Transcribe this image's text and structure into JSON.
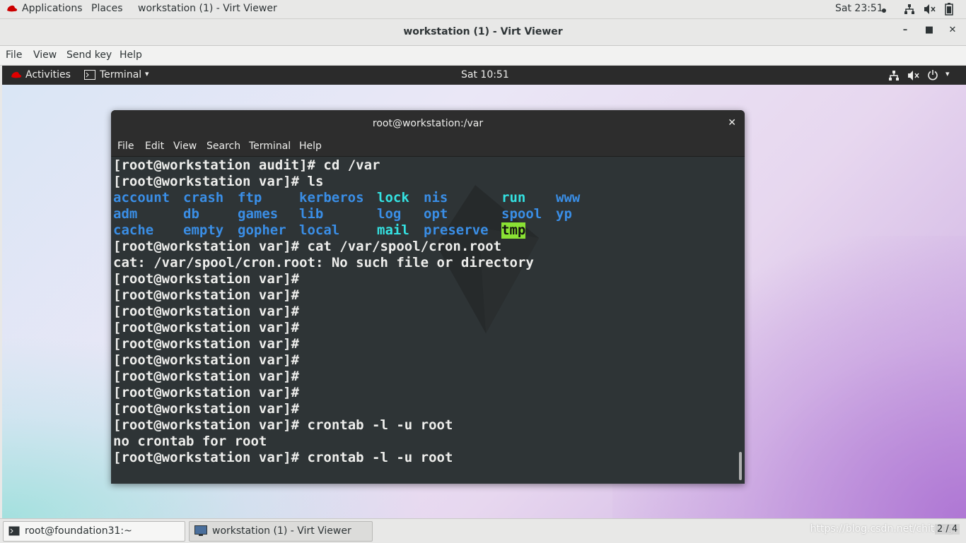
{
  "host_topbar": {
    "applications": "Applications",
    "places": "Places",
    "window_title": "workstation (1) - Virt Viewer",
    "clock": "Sat 23:51"
  },
  "vv_window": {
    "title": "workstation (1) - Virt Viewer",
    "menu": [
      "File",
      "View",
      "Send key",
      "Help"
    ]
  },
  "guest_topbar": {
    "activities": "Activities",
    "app": "Terminal",
    "clock": "Sat 10:51"
  },
  "terminal": {
    "title": "root@workstation:/var",
    "menu": [
      "File",
      "Edit",
      "View",
      "Search",
      "Terminal",
      "Help"
    ],
    "lines_before": [
      "[root@workstation audit]# cd /var",
      "[root@workstation var]# ls"
    ],
    "ls_rows": [
      [
        "account",
        "crash",
        "ftp",
        "kerberos",
        "lock",
        "nis",
        "run",
        "www"
      ],
      [
        "adm",
        "db",
        "games",
        "lib",
        "log",
        "opt",
        "spool",
        "yp"
      ],
      [
        "cache",
        "empty",
        "gopher",
        "local",
        "mail",
        "preserve",
        "tmp",
        ""
      ]
    ],
    "lines_after": [
      "[root@workstation var]# cat /var/spool/cron.root",
      "cat: /var/spool/cron.root: No such file or directory",
      "[root@workstation var]#",
      "[root@workstation var]#",
      "[root@workstation var]#",
      "[root@workstation var]#",
      "[root@workstation var]#",
      "[root@workstation var]#",
      "[root@workstation var]#",
      "[root@workstation var]#",
      "[root@workstation var]#",
      "[root@workstation var]# crontab -l -u root",
      "no crontab for root",
      "[root@workstation var]# crontab -l -u root"
    ]
  },
  "host_taskbar": {
    "task1": "root@foundation31:~",
    "task2": "workstation (1) - Virt Viewer",
    "workspace": "2 / 4",
    "watermark": "https://blog.csdn.net/chitung"
  },
  "colors": {
    "terminal_bg": "#2e3436",
    "dir_blue": "#3a8ee6",
    "symlink_cyan": "#34e2e2",
    "sticky_green": "#8ae234"
  }
}
